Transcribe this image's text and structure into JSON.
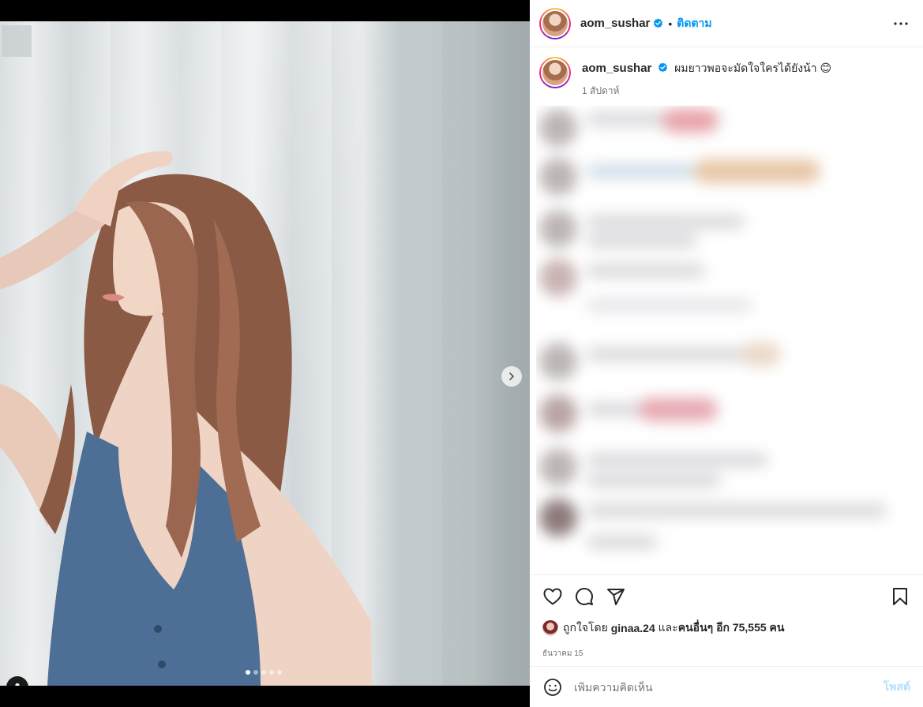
{
  "post": {
    "username": "aom_sushar",
    "follow_label": "ติดตาม",
    "separator": "•",
    "caption_text": "ผมยาวพอจะมัดใจใครได้ยังน้า 😊",
    "caption_time": "1 สัปดาห์",
    "likes": {
      "prefix": "ถูกใจโดย",
      "liker": "ginaa.24",
      "middle": "และ",
      "others": "คนอื่นๆ อีก 75,555 คน"
    },
    "date": "ธันวาคม 15",
    "comment_placeholder": "เพิ่มความคิดเห็น",
    "post_label": "โพสต์"
  },
  "carousel": {
    "total": 5,
    "active": 1
  },
  "colors": {
    "link_blue": "#0095f6",
    "post_disabled": "#b2dffc",
    "verified_blue": "#0095f6"
  },
  "icons": {
    "header_more": "more-horizontal-icon",
    "like": "heart-icon",
    "comment": "comment-icon",
    "share": "share-icon",
    "save": "bookmark-icon",
    "emoji": "emoji-icon",
    "next": "chevron-right-icon",
    "user_tag": "user-tag-icon",
    "verified": "verified-badge-icon"
  }
}
